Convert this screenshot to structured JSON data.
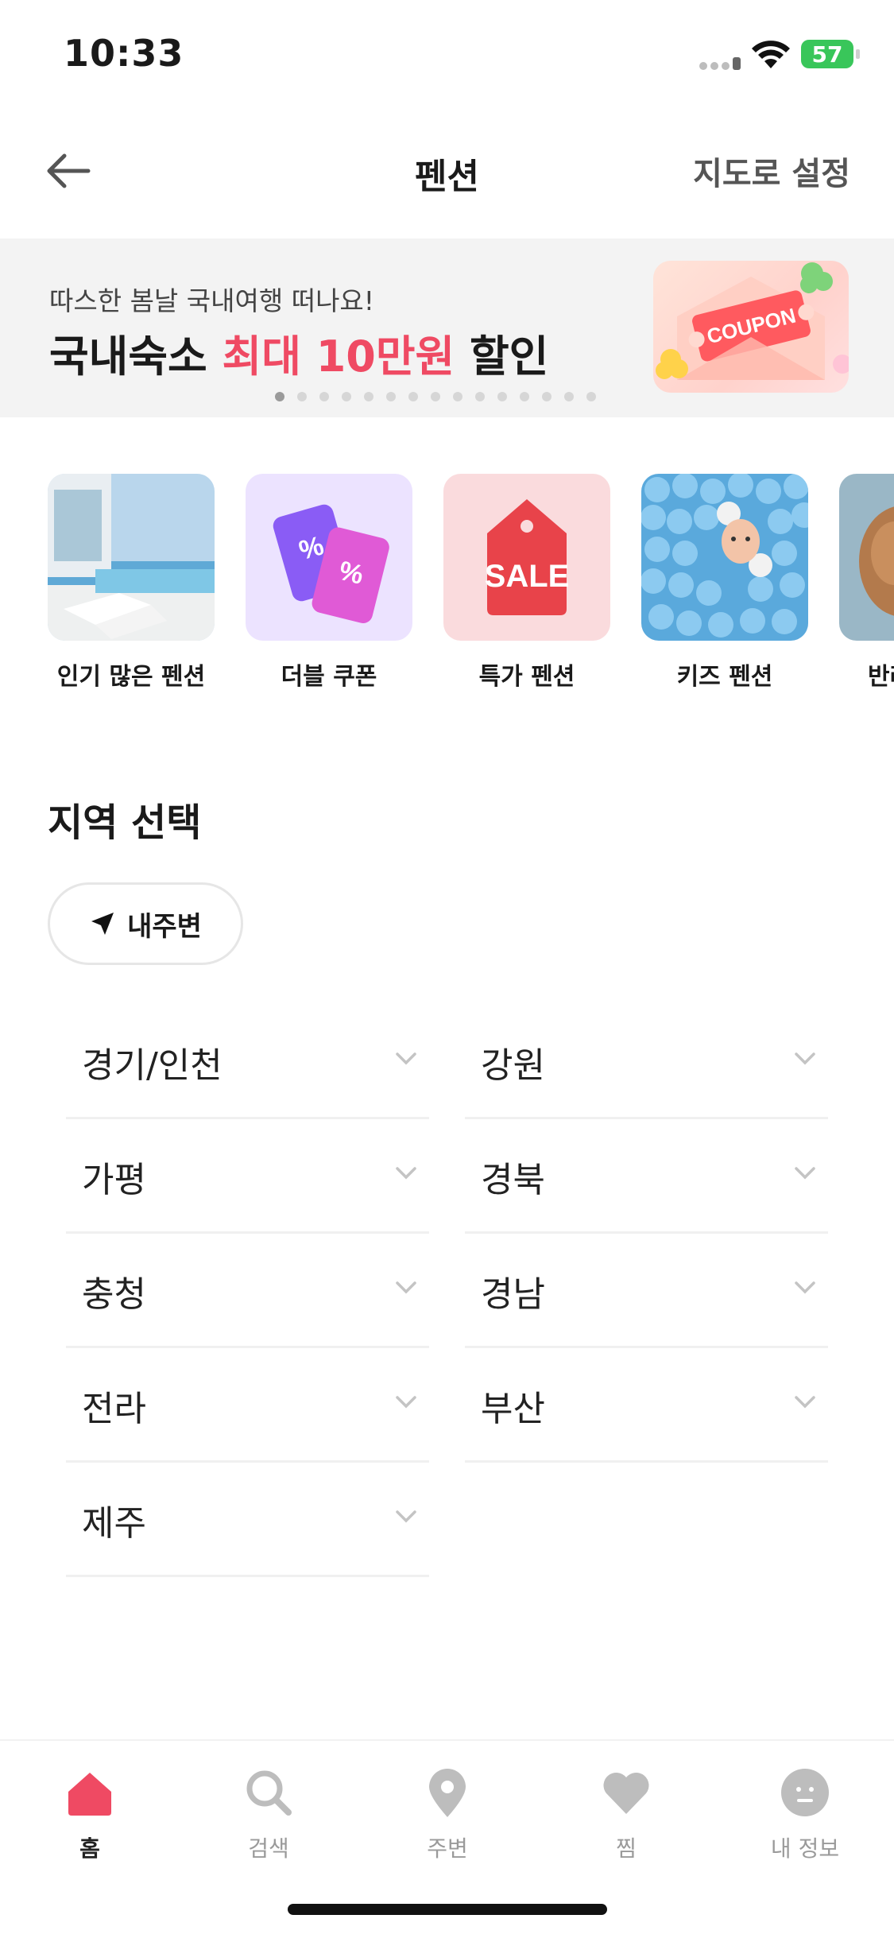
{
  "status_bar": {
    "time": "10:33",
    "battery": "57"
  },
  "header": {
    "title": "펜션",
    "map_button": "지도로 설정"
  },
  "banner": {
    "subtitle": "따스한 봄날 국내여행 떠나요!",
    "title_prefix": "국내숙소 ",
    "title_highlight": "최대 10만원",
    "title_suffix": " 할인",
    "image_text": "COUPON"
  },
  "categories": [
    {
      "label": "인기 많은 펜션",
      "icon": "pool-villa-photo"
    },
    {
      "label": "더블 쿠폰",
      "icon": "double-coupon-icon"
    },
    {
      "label": "특가 펜션",
      "icon": "sale-tag-icon",
      "tag_text": "SALE"
    },
    {
      "label": "키즈 펜션",
      "icon": "kids-ball-pit-photo"
    },
    {
      "label": "반려",
      "icon": "dog-photo"
    }
  ],
  "region_section": {
    "title": "지역 선택",
    "nearby_button": "내주변",
    "regions": [
      "경기/인천",
      "강원",
      "가평",
      "경북",
      "충청",
      "경남",
      "전라",
      "부산",
      "제주"
    ]
  },
  "tabbar": {
    "items": [
      {
        "label": "홈",
        "icon": "home-icon",
        "active": true
      },
      {
        "label": "검색",
        "icon": "search-icon",
        "active": false
      },
      {
        "label": "주변",
        "icon": "location-pin-icon",
        "active": false
      },
      {
        "label": "찜",
        "icon": "heart-icon",
        "active": false
      },
      {
        "label": "내 정보",
        "icon": "profile-icon",
        "active": false
      }
    ]
  },
  "colors": {
    "accent": "#ef4a63",
    "battery": "#39c65a",
    "inactive": "#bdbdbd"
  }
}
